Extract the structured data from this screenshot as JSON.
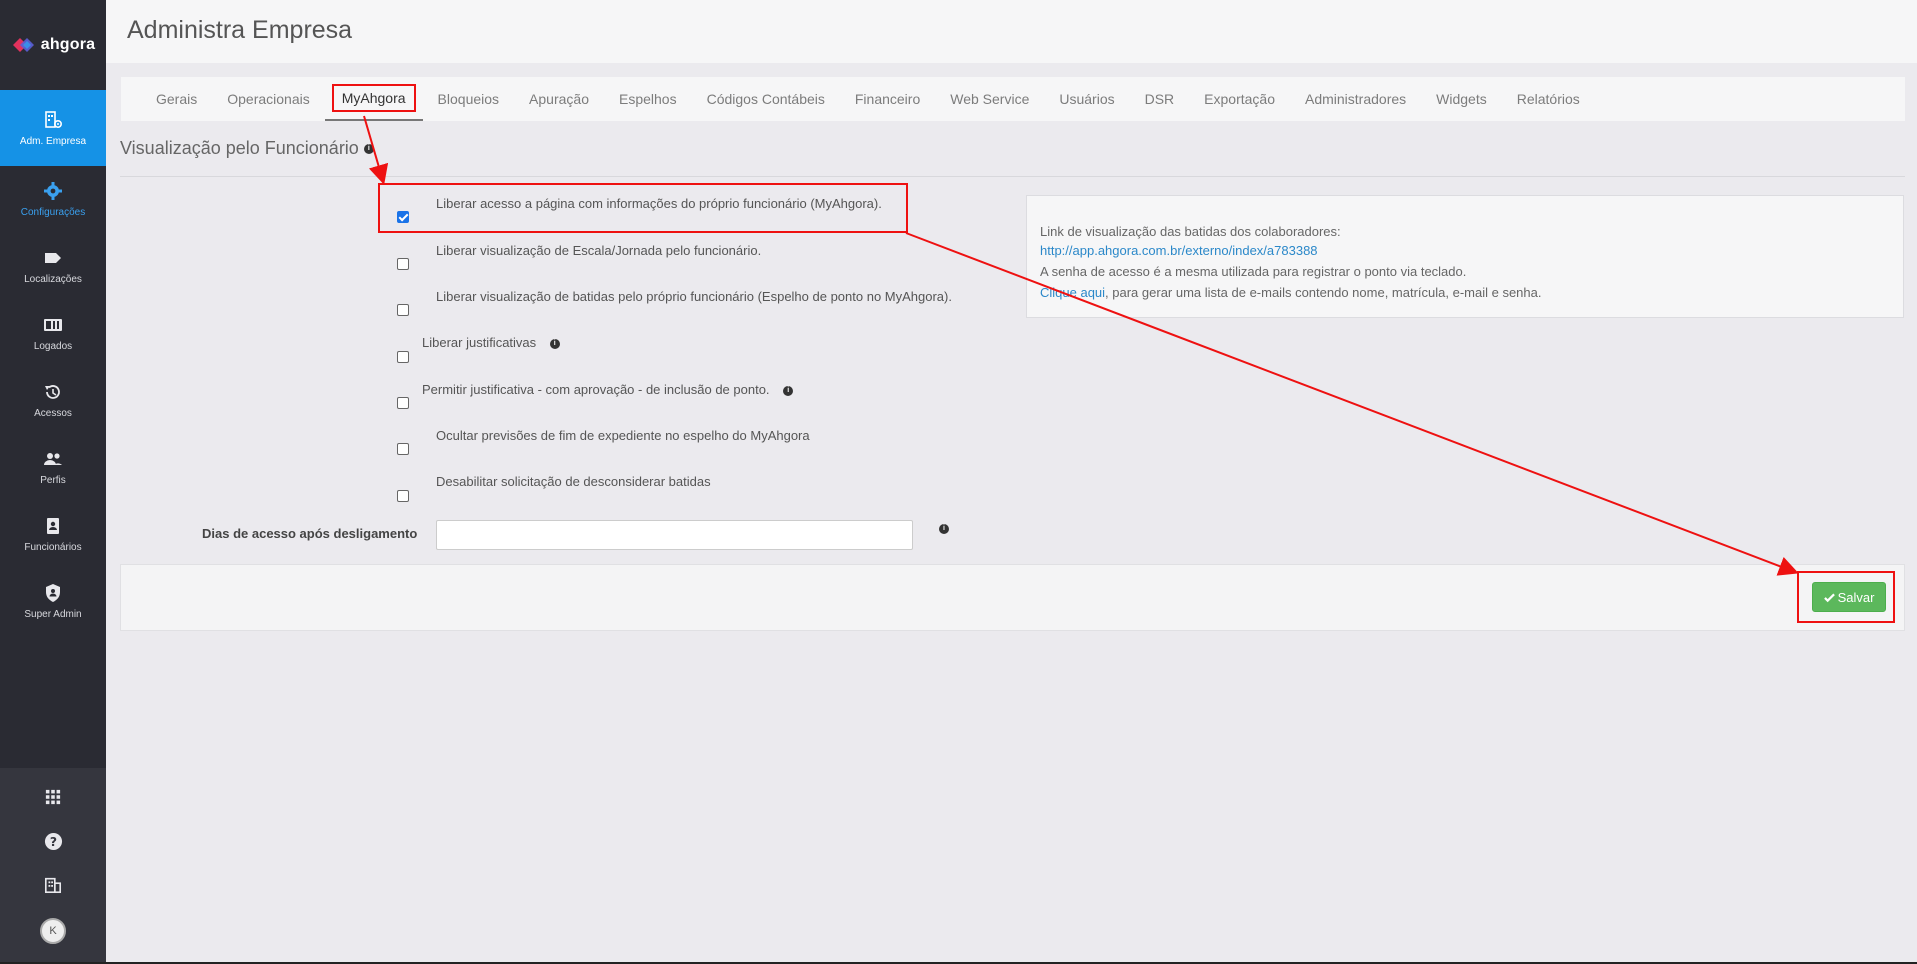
{
  "brand": {
    "name": "ahgora"
  },
  "sidebar": {
    "items": [
      {
        "label": "Adm. Empresa",
        "icon": "building-settings-icon"
      },
      {
        "label": "Configurações",
        "icon": "gear-icon"
      },
      {
        "label": "Localizações",
        "icon": "tag-icon"
      },
      {
        "label": "Logados",
        "icon": "id-card-icon"
      },
      {
        "label": "Acessos",
        "icon": "history-icon"
      },
      {
        "label": "Perfis",
        "icon": "users-icon"
      },
      {
        "label": "Funcionários",
        "icon": "badge-icon"
      },
      {
        "label": "Super Admin",
        "icon": "shield-user-icon"
      }
    ],
    "bottom": {
      "avatar_initial": "K"
    }
  },
  "header": {
    "title": "Administra Empresa"
  },
  "tabs": [
    {
      "label": "Gerais"
    },
    {
      "label": "Operacionais"
    },
    {
      "label": "MyAhgora"
    },
    {
      "label": "Bloqueios"
    },
    {
      "label": "Apuração"
    },
    {
      "label": "Espelhos"
    },
    {
      "label": "Códigos Contábeis"
    },
    {
      "label": "Financeiro"
    },
    {
      "label": "Web Service"
    },
    {
      "label": "Usuários"
    },
    {
      "label": "DSR"
    },
    {
      "label": "Exportação"
    },
    {
      "label": "Administradores"
    },
    {
      "label": "Widgets"
    },
    {
      "label": "Relatórios"
    }
  ],
  "section": {
    "title": "Visualização pelo Funcionário"
  },
  "options": [
    {
      "label": "Liberar acesso a página com informações do próprio funcionário (MyAhgora).",
      "checked": true
    },
    {
      "label": "Liberar visualização de Escala/Jornada pelo funcionário.",
      "checked": false
    },
    {
      "label": "Liberar visualização de batidas pelo próprio funcionário (Espelho de ponto no MyAhgora).",
      "checked": false
    },
    {
      "label": "Liberar justificativas",
      "checked": false
    },
    {
      "label": "Permitir justificativa - com aprovação - de inclusão de ponto.",
      "checked": false
    },
    {
      "label": "Ocultar previsões de fim de expediente no espelho do MyAhgora",
      "checked": false
    },
    {
      "label": "Desabilitar solicitação de desconsiderar batidas",
      "checked": false
    }
  ],
  "infobox": {
    "line1": "Link de visualização das batidas dos colaboradores:",
    "link": "http://app.ahgora.com.br/externo/index/a783388",
    "line3": "A senha de acesso é a mesma utilizada para registrar o ponto via teclado.",
    "click_link": "Clique aqui",
    "line4_rest": ", para gerar uma lista de e-mails contendo nome, matrícula, e-mail e senha."
  },
  "dias": {
    "label": "Dias de acesso após desligamento",
    "value": ""
  },
  "actions": {
    "save_label": "Salvar"
  },
  "colors": {
    "sidebar": "#2a2b33",
    "accent": "#1592e6",
    "save": "#5cb85c",
    "annotation": "#ee1111"
  }
}
